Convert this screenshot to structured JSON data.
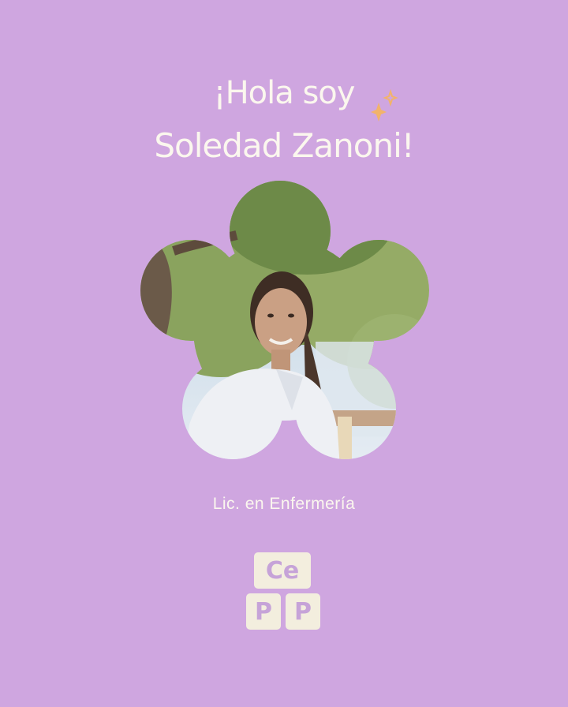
{
  "headline": {
    "line1": "¡Hola soy",
    "line2": "Soledad Zanoni!"
  },
  "subtitle": "Lic. en Enfermería",
  "logo": {
    "top": "Ce",
    "bottom_left": "P",
    "bottom_right": "P"
  },
  "icons": {
    "sparkle": "sparkle-icon"
  },
  "colors": {
    "background": "#cfa6e0",
    "text": "#fbf7ee",
    "sparkle": "#f2b36b",
    "logo_block": "#f3eede",
    "logo_text": "#c6a3d8"
  }
}
